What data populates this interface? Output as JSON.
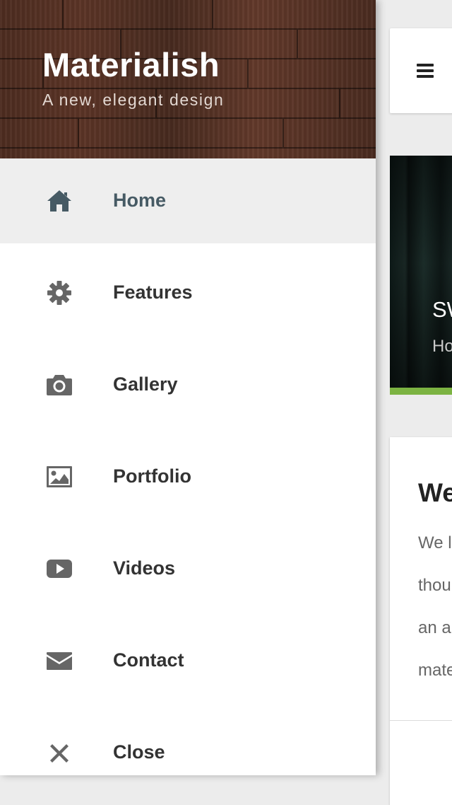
{
  "drawer": {
    "title": "Materialish",
    "tagline": "A new, elegant design",
    "items": [
      {
        "label": "Home",
        "icon": "home-icon",
        "active": true
      },
      {
        "label": "Features",
        "icon": "gear-icon",
        "active": false
      },
      {
        "label": "Gallery",
        "icon": "camera-icon",
        "active": false
      },
      {
        "label": "Portfolio",
        "icon": "image-icon",
        "active": false
      },
      {
        "label": "Videos",
        "icon": "youtube-play-icon",
        "active": false
      },
      {
        "label": "Contact",
        "icon": "envelope-icon",
        "active": false
      },
      {
        "label": "Close",
        "icon": "close-icon",
        "active": false
      }
    ]
  },
  "content": {
    "menu_icon": "hamburger-menu-icon",
    "slider": {
      "title": "SW",
      "subtitle": "Ho",
      "accent_color": "#7cb342"
    },
    "card": {
      "title": "We",
      "lines": [
        "We l",
        "thou",
        "an a",
        "mate"
      ]
    }
  },
  "colors": {
    "active_item_bg": "#eeeeee",
    "active_item_text": "#465a64",
    "item_text": "#333333",
    "icon": "#666666",
    "active_icon": "#465a64"
  }
}
